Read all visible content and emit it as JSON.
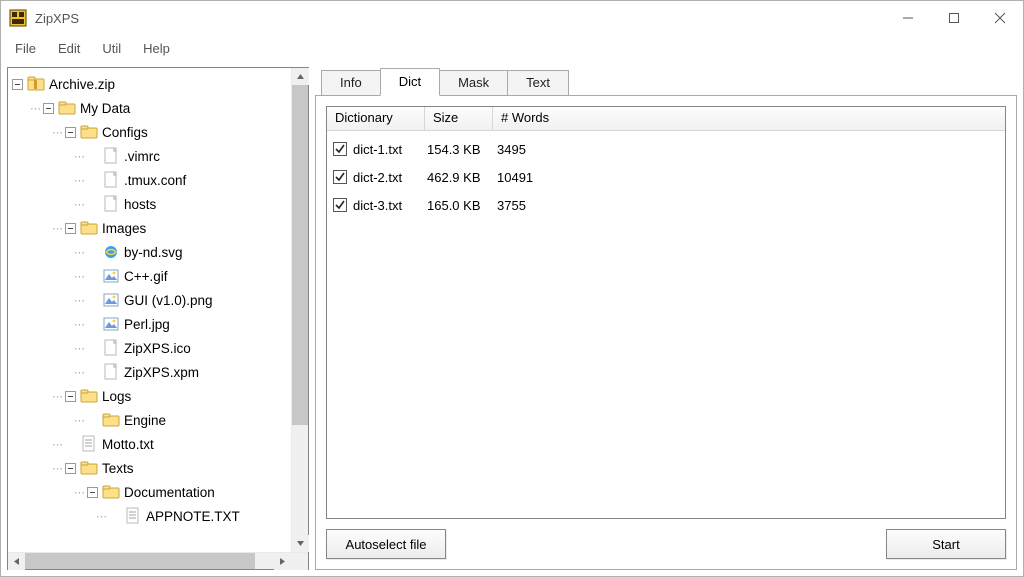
{
  "window": {
    "title": "ZipXPS"
  },
  "menu": {
    "file": "File",
    "edit": "Edit",
    "util": "Util",
    "help": "Help"
  },
  "tree": {
    "root": {
      "label": "Archive.zip",
      "children": [
        {
          "label": "My Data",
          "children": [
            {
              "label": "Configs",
              "children": [
                {
                  "label": ".vimrc",
                  "icon": "file"
                },
                {
                  "label": ".tmux.conf",
                  "icon": "file"
                },
                {
                  "label": "hosts",
                  "icon": "file"
                }
              ]
            },
            {
              "label": "Images",
              "children": [
                {
                  "label": "by-nd.svg",
                  "icon": "ie"
                },
                {
                  "label": "C++.gif",
                  "icon": "image"
                },
                {
                  "label": "GUI (v1.0).png",
                  "icon": "image"
                },
                {
                  "label": "Perl.jpg",
                  "icon": "image"
                },
                {
                  "label": "ZipXPS.ico",
                  "icon": "file"
                },
                {
                  "label": "ZipXPS.xpm",
                  "icon": "file"
                }
              ]
            },
            {
              "label": "Logs",
              "children": [
                {
                  "label": "Engine",
                  "icon": "folder",
                  "leaf_folder": true
                }
              ]
            },
            {
              "label": "Motto.txt",
              "icon": "text"
            },
            {
              "label": "Texts",
              "children": [
                {
                  "label": "Documentation",
                  "children": [
                    {
                      "label": "APPNOTE.TXT",
                      "icon": "text",
                      "cut": true
                    }
                  ]
                }
              ]
            }
          ]
        }
      ]
    }
  },
  "tabs": {
    "info": "Info",
    "dict": "Dict",
    "mask": "Mask",
    "text": "Text",
    "active": "dict"
  },
  "dict": {
    "headers": {
      "dictionary": "Dictionary",
      "size": "Size",
      "words": "# Words"
    },
    "rows": [
      {
        "checked": true,
        "name": "dict-1.txt",
        "size": "154.3 KB",
        "words": "3495"
      },
      {
        "checked": true,
        "name": "dict-2.txt",
        "size": "462.9 KB",
        "words": "10491"
      },
      {
        "checked": true,
        "name": "dict-3.txt",
        "size": "165.0 KB",
        "words": "3755"
      }
    ]
  },
  "buttons": {
    "autoselect": "Autoselect file",
    "start": "Start"
  }
}
